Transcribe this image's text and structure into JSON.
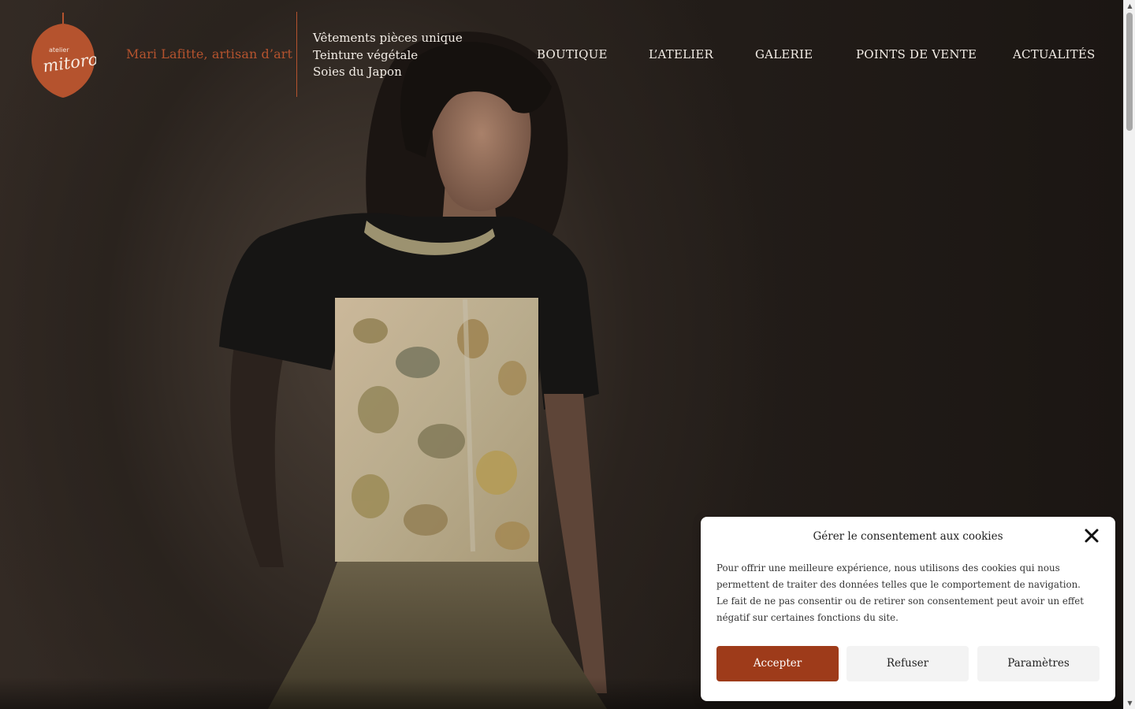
{
  "brand": {
    "logo_small_text": "atelier",
    "logo_script_text": "mitoro",
    "tagline": "Mari Lafitte, artisan d’art",
    "accent_color": "#b5532e"
  },
  "header_features": [
    "Vêtements pièces unique",
    "Teinture végétale",
    "Soies du Japon"
  ],
  "nav": {
    "items": [
      {
        "label": "BOUTIQUE"
      },
      {
        "label": "L’ATELIER"
      },
      {
        "label": "GALERIE"
      },
      {
        "label": "POINTS DE VENTE"
      },
      {
        "label": "ACTUALITÉS"
      }
    ]
  },
  "cookie_banner": {
    "title": "Gérer le consentement aux cookies",
    "close_icon": "close-icon",
    "text": "Pour offrir une meilleure expérience, nous utilisons des cookies qui nous permettent de traiter des données telles que le comportement de navigation. Le fait de ne pas consentir ou de retirer son consentement peut avoir un effet négatif sur certaines fonctions du site.",
    "accept_label": "Accepter",
    "refuse_label": "Refuser",
    "settings_label": "Paramètres",
    "accept_color": "#9e3b1a"
  }
}
